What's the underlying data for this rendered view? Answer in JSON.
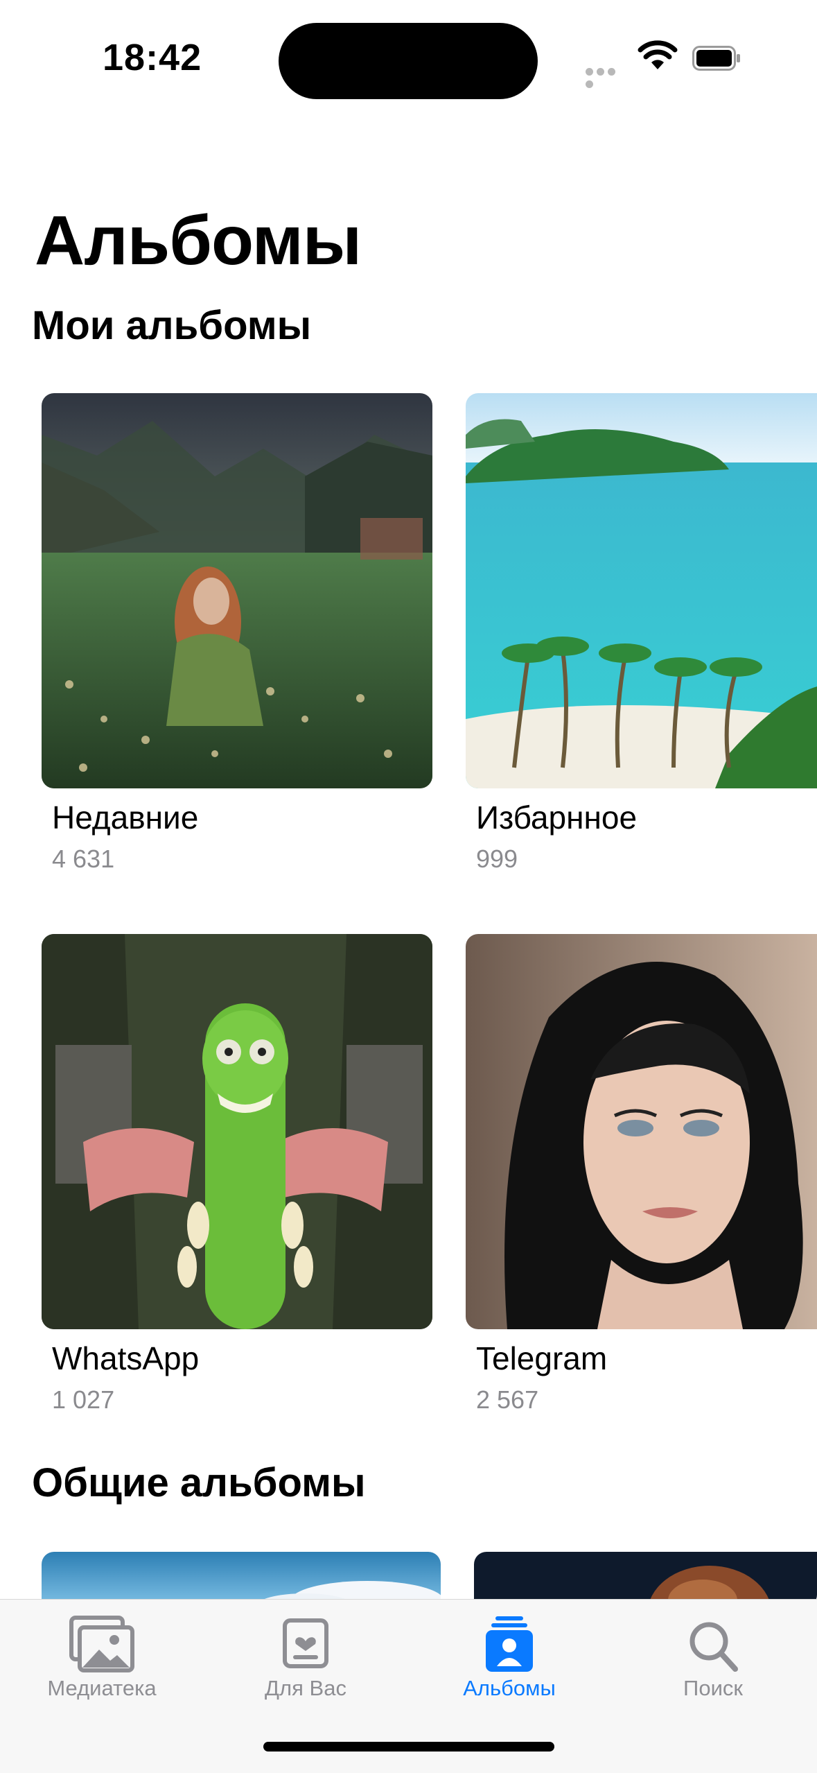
{
  "status_bar": {
    "time": "18:42"
  },
  "page": {
    "title": "Альбомы"
  },
  "my_albums": {
    "title": "Мои альбомы",
    "items": [
      {
        "name": "Недавние",
        "count": "4 631"
      },
      {
        "name": "Избарнное",
        "count": "999"
      },
      {
        "name": "WhatsApp",
        "count": "1 027"
      },
      {
        "name": "Telegram",
        "count": "2 567"
      }
    ]
  },
  "shared_albums": {
    "title": "Общие альбомы"
  },
  "tab_bar": {
    "tabs": [
      {
        "label": "Медиатека"
      },
      {
        "label": "Для Вас"
      },
      {
        "label": "Альбомы"
      },
      {
        "label": "Поиск"
      }
    ],
    "active_index": 2,
    "accent_color": "#0a7aff",
    "inactive_color": "#8e8e93"
  }
}
